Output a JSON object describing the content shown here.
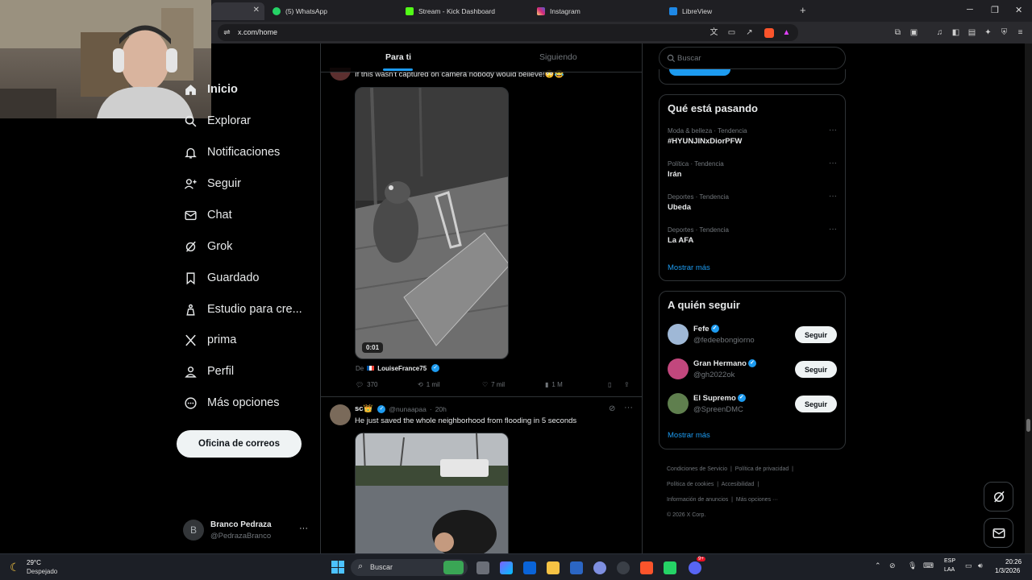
{
  "browser": {
    "tabs": [
      {
        "label": ""
      },
      {
        "label": "(5) WhatsApp"
      },
      {
        "label": "Stream - Kick Dashboard"
      },
      {
        "label": "Instagram"
      },
      {
        "label": "LibreView"
      }
    ],
    "new_tab": "+",
    "url": "x.com/home",
    "window_controls": {
      "minimize": "─",
      "restore": "❐",
      "close": "✕"
    }
  },
  "nav": {
    "items": [
      {
        "label": "Inicio",
        "icon": "home-icon"
      },
      {
        "label": "Explorar",
        "icon": "search-icon"
      },
      {
        "label": "Notificaciones",
        "icon": "bell-icon"
      },
      {
        "label": "Seguir",
        "icon": "follow-icon"
      },
      {
        "label": "Chat",
        "icon": "mail-icon"
      },
      {
        "label": "Grok",
        "icon": "grok-icon"
      },
      {
        "label": "Guardado",
        "icon": "bookmark-icon"
      },
      {
        "label": "Estudio para cre...",
        "icon": "studio-icon"
      },
      {
        "label": "prima",
        "icon": "x-logo-icon"
      },
      {
        "label": "Perfil",
        "icon": "person-icon"
      },
      {
        "label": "Más opciones",
        "icon": "more-icon"
      }
    ],
    "post_button": "Oficina de correos",
    "profile": {
      "name": "Branco Pedraza",
      "handle": "@PedrazaBranco",
      "initial": "B",
      "more": "···"
    }
  },
  "feed": {
    "tabs": [
      {
        "label": "Para ti"
      },
      {
        "label": "Siguiendo"
      }
    ],
    "tweet1": {
      "text": "If this wasn't captured on camera nobody would believe!😳😂",
      "video_time": "0:01",
      "from_prefix": "De",
      "from_user": "LouiseFrance75",
      "actions": {
        "replies": "370",
        "retweets": "1 mil",
        "likes": "7 mil",
        "views": "1 M"
      }
    },
    "tweet2": {
      "name": "sc👑",
      "handle": "@nunaapaa",
      "time": "20h",
      "text": "He just saved the whole neighborhood from flooding in 5 seconds",
      "more": "···"
    }
  },
  "right": {
    "search_placeholder": "Buscar",
    "trends": {
      "title": "Qué está pasando",
      "items": [
        {
          "category": "Moda & belleza · Tendencia",
          "name": "#HYUNJINxDiorPFW"
        },
        {
          "category": "Política · Tendencia",
          "name": "Irán"
        },
        {
          "category": "Deportes · Tendencia",
          "name": "Ubeda"
        },
        {
          "category": "Deportes · Tendencia",
          "name": "La AFA"
        }
      ],
      "more": "Mostrar más",
      "dots": "···"
    },
    "who_to_follow": {
      "title": "A quién seguir",
      "users": [
        {
          "name": "Fefe",
          "handle": "@fedeebongiorno",
          "button": "Seguir"
        },
        {
          "name": "Gran Hermano",
          "handle": "@gh2022ok",
          "button": "Seguir"
        },
        {
          "name": "El Supremo",
          "handle": "@SpreenDMC",
          "button": "Seguir"
        }
      ],
      "more": "Mostrar más"
    },
    "footer": {
      "links": [
        "Condiciones de Servicio",
        "Política de privacidad",
        "Política de cookies",
        "Accesibilidad",
        "Información de anuncios",
        "Más opciones ···"
      ],
      "copyright": "© 2026 X Corp."
    }
  },
  "taskbar": {
    "weather_temp": "29°C",
    "weather_desc": "Despejado",
    "search": "Buscar",
    "lang1": "ESP",
    "lang2": "LAA",
    "time": "20:26",
    "date": "1/3/2026",
    "discord_badge": "9+"
  },
  "colors": {
    "accent": "#1d9bf0",
    "bg": "#000000",
    "border": "#2f3336",
    "muted": "#71767b"
  }
}
